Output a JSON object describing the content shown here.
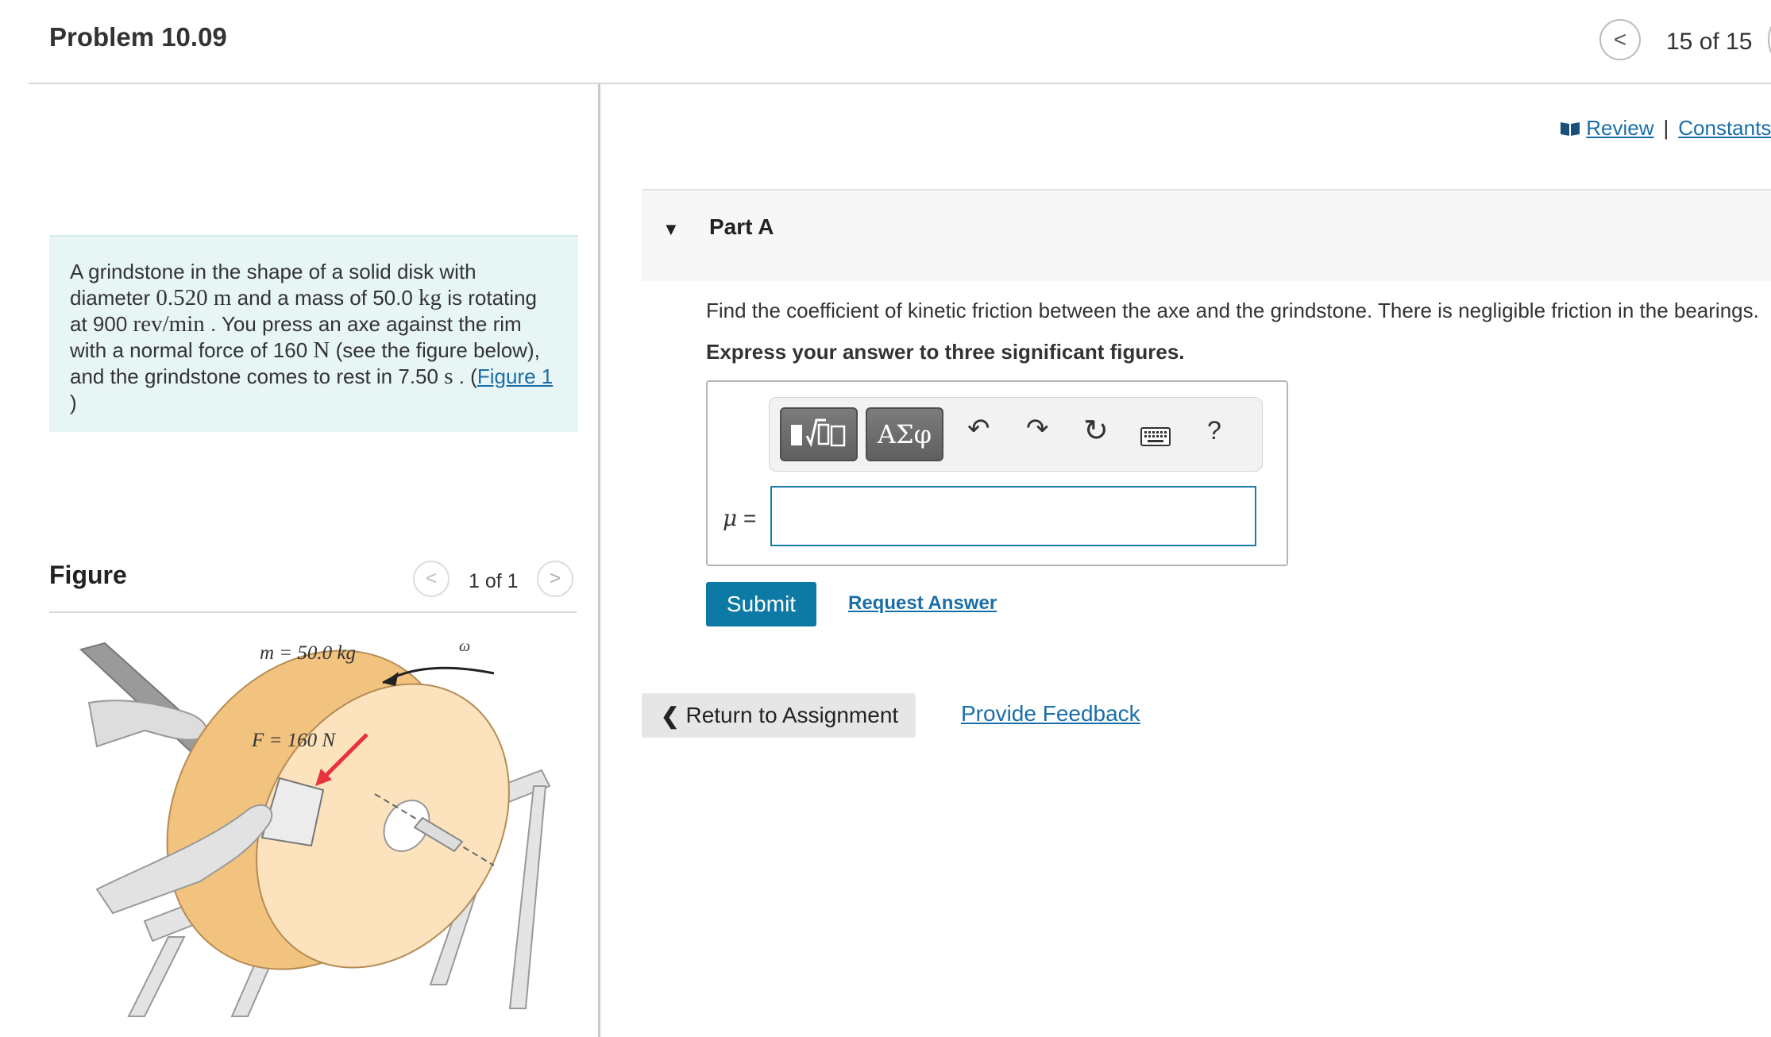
{
  "header": {
    "title": "Problem 10.09",
    "nav_prev": "<",
    "position": "15 of 15"
  },
  "problem": {
    "text_1": "A grindstone in the shape of a solid disk with diameter ",
    "diameter": "0.520",
    "diameter_unit": "m",
    "text_2": " and a mass of ",
    "mass": "50.0",
    "mass_unit": "kg",
    "text_3": " is rotating at ",
    "speed": "900",
    "speed_unit": "rev/min",
    "text_4": " . You press an axe against the rim with a normal force of ",
    "force": "160",
    "force_unit": "N",
    "text_5": " (see the figure below), and the grindstone comes to rest in ",
    "time": "7.50",
    "time_unit": "s",
    "text_6": " . (",
    "figure_link": "Figure 1",
    "text_7": ")"
  },
  "figure": {
    "label": "Figure",
    "nav_prev": "<",
    "count": "1 of 1",
    "nav_next": ">",
    "mass_label": "m = 50.0 kg",
    "force_label": "F = 160 N",
    "omega_label": "ω"
  },
  "links": {
    "review": "Review",
    "separator": "|",
    "constants": "Constants"
  },
  "part": {
    "toggle": "▼",
    "title": "Part A",
    "question": "Find the coefficient of kinetic friction between the axe and the grindstone. There is negligible friction in the bearings.",
    "instruction": "Express your answer to three significant figures."
  },
  "toolbar": {
    "greek_label": "ΑΣφ",
    "undo_icon": "↶",
    "redo_icon": "↷",
    "reset_icon": "↻",
    "help_label": "?"
  },
  "answer": {
    "variable": "μ",
    "equals": " =",
    "value": ""
  },
  "actions": {
    "submit": "Submit",
    "request_answer": "Request Answer",
    "return_chevron": "❮",
    "return_label": "Return to Assignment",
    "feedback": "Provide Feedback"
  },
  "colors": {
    "link": "#1a6ea8",
    "submit_bg": "#0d7aa6",
    "problem_bg": "#e8f5f5",
    "grindstone": "#f6c98f"
  }
}
